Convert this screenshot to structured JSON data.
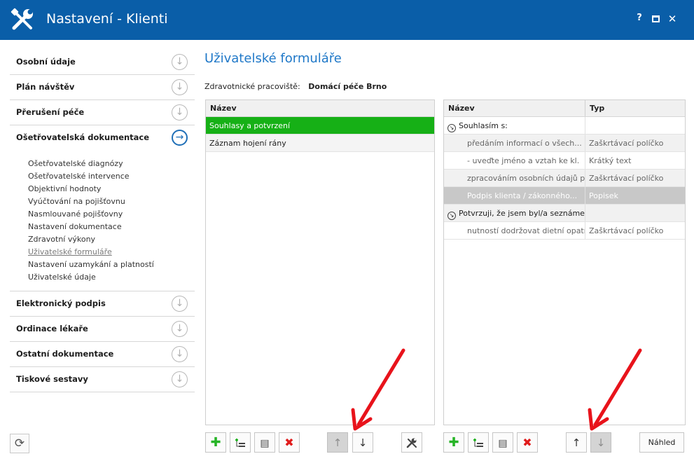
{
  "window": {
    "title": "Nastavení - Klienti",
    "buttons": {
      "help": "?",
      "maximize": "maximize",
      "close": "✕"
    },
    "accent": "#0a5ea8"
  },
  "nav": {
    "items_top": [
      {
        "label": "Osobní údaje"
      },
      {
        "label": "Plán návštěv"
      },
      {
        "label": "Přerušení péče"
      },
      {
        "label": "Ošetřovatelská dokumentace",
        "active": true
      }
    ],
    "subitems": [
      "Ošetřovatelské diagnózy",
      "Ošetřovatelské intervence",
      "Objektivní hodnoty",
      "Vyúčtování na pojišťovnu",
      "Nasmlouvané pojišťovny",
      "Nastavení dokumentace",
      "Zdravotní výkony",
      "Uživatelské formuláře",
      "Nastavení uzamykání a platností",
      "Uživatelské údaje"
    ],
    "current_subitem": "Uživatelské formuláře",
    "items_bottom": [
      {
        "label": "Elektronický podpis"
      },
      {
        "label": "Ordinace lékaře"
      },
      {
        "label": "Ostatní dokumentace"
      },
      {
        "label": "Tiskové sestavy"
      }
    ]
  },
  "main": {
    "title": "Uživatelské formuláře",
    "workplace_label": "Zdravotnické pracoviště:",
    "workplace_value": "Domácí péče Brno",
    "left_grid": {
      "header": "Název",
      "rows": [
        "Souhlasy a potvrzení",
        "Záznam hojení rány"
      ],
      "selected_index": 0,
      "selected_color": "#16b016"
    },
    "right_grid": {
      "headers": {
        "name": "Název",
        "type": "Typ"
      },
      "rows": [
        {
          "name": "Souhlasím s:",
          "type": "",
          "kind": "group"
        },
        {
          "name": "předáním informací o všech...",
          "type": "Zaškrtávací políčko",
          "kind": "child"
        },
        {
          "name": "- uveďte jméno a vztah ke kl.",
          "type": "Krátký text",
          "kind": "child"
        },
        {
          "name": "zpracováním osobních údajů pro...",
          "type": "Zaškrtávací políčko",
          "kind": "child"
        },
        {
          "name": "Podpis klienta / zákonného...",
          "type": "Popisek",
          "kind": "child-highlight"
        },
        {
          "name": "Potvrzuji, že jsem byl/a seznámen/...",
          "type": "",
          "kind": "group"
        },
        {
          "name": "nutností dodržovat dietní opatř...",
          "type": "Zaškrtávací políčko",
          "kind": "child"
        }
      ]
    },
    "preview_label": "Náhled"
  },
  "icons": {
    "refresh": "refresh-icon",
    "add": "plus-icon",
    "add_sub": "add-subitem-icon",
    "edit": "edit-document-icon",
    "delete": "delete-icon",
    "up": "arrow-up-icon",
    "down": "arrow-down-icon",
    "settings": "wrench-icon",
    "nav_down": "circle-arrow-down-icon",
    "nav_right": "circle-arrow-right-icon"
  },
  "annotation_color": "#e8131b"
}
